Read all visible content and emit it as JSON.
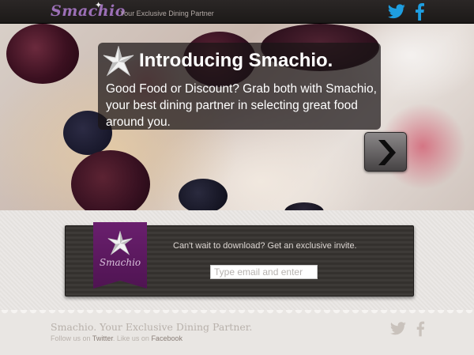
{
  "header": {
    "logo_text": "Smachio",
    "tagline": "Your Exclusive Dining Partner",
    "icons": [
      "twitter-icon",
      "facebook-icon"
    ]
  },
  "hero": {
    "title": "Introducing Smachio.",
    "text": "Good Food or Discount? Grab both with Smachio, your best dining partner in selecting great food around you.",
    "next_icon": "chevron-right-icon"
  },
  "invite": {
    "ribbon_text": "Smachio",
    "prompt": "Can't wait to download? Get an exclusive invite.",
    "email_placeholder": "Type email and enter"
  },
  "footer": {
    "title": "Smachio. Your Exclusive Dining Partner.",
    "follow_prefix": "Follow us on",
    "twitter_link": "Twitter",
    "like_prefix": ". Like us on",
    "facebook_link": "Facebook",
    "icons": [
      "twitter-icon",
      "facebook-icon"
    ]
  },
  "colors": {
    "brand_purple": "#6a1f6e",
    "twitter_blue": "#1e9ee0",
    "header_dark": "#231f1e"
  }
}
